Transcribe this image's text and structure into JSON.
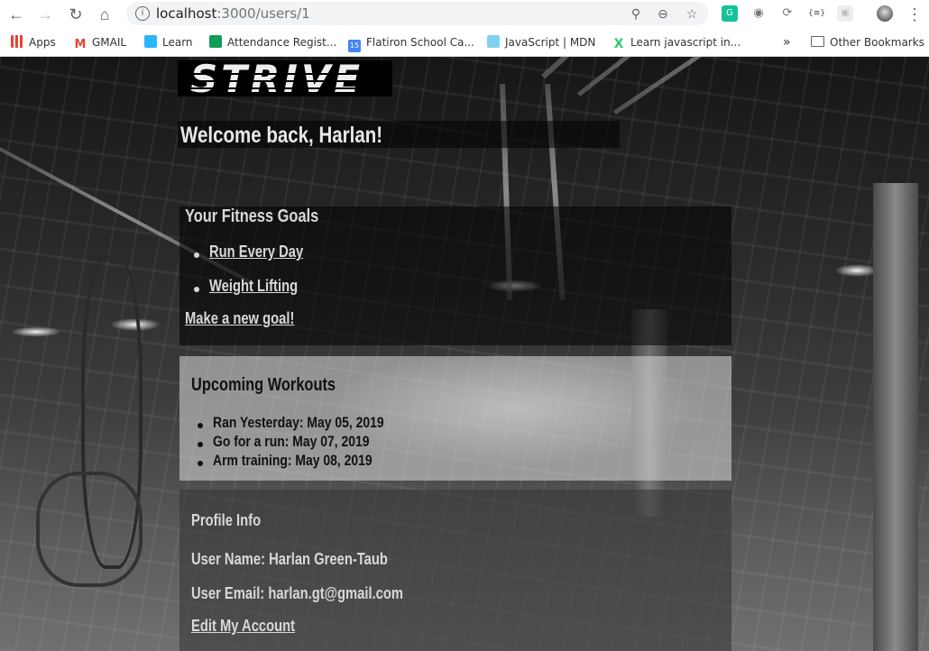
{
  "browser": {
    "url_host": "localhost",
    "url_path": ":3000/users/1",
    "bookmarks": [
      {
        "label": "Apps",
        "icon": "apps-grid-icon",
        "color": "#4285f4"
      },
      {
        "label": "GMAIL",
        "icon": "gmail-icon",
        "color": "#ea4335"
      },
      {
        "label": "Learn",
        "icon": "learn-icon",
        "color": "#29b6f6"
      },
      {
        "label": "Attendance Regist...",
        "icon": "sheets-icon",
        "color": "#0f9d58"
      },
      {
        "label": "Flatiron School Ca...",
        "icon": "calendar-icon",
        "color": "#4285f4"
      },
      {
        "label": "JavaScript | MDN",
        "icon": "mdn-icon",
        "color": "#83d0f2"
      },
      {
        "label": "Learn javascript in...",
        "icon": "learnx-icon",
        "color": "#2ecc71"
      }
    ],
    "more_label": "»",
    "other_bookmarks": "Other Bookmarks"
  },
  "app": {
    "logo": "STRIVE",
    "welcome": "Welcome back, Harlan!",
    "goals": {
      "title": "Your Fitness Goals",
      "items": [
        "Run Every Day",
        "Weight Lifting"
      ],
      "new_goal_link": "Make a new goal!"
    },
    "workouts": {
      "title": "Upcoming Workouts",
      "items": [
        "Ran Yesterday: May 05, 2019",
        "Go for a run: May 07, 2019",
        "Arm training: May 08, 2019"
      ]
    },
    "profile": {
      "title": "Profile Info",
      "user_name": "User Name: Harlan Green-Taub",
      "user_email": "User Email: harlan.gt@gmail.com",
      "edit_link": "Edit My Account"
    }
  }
}
